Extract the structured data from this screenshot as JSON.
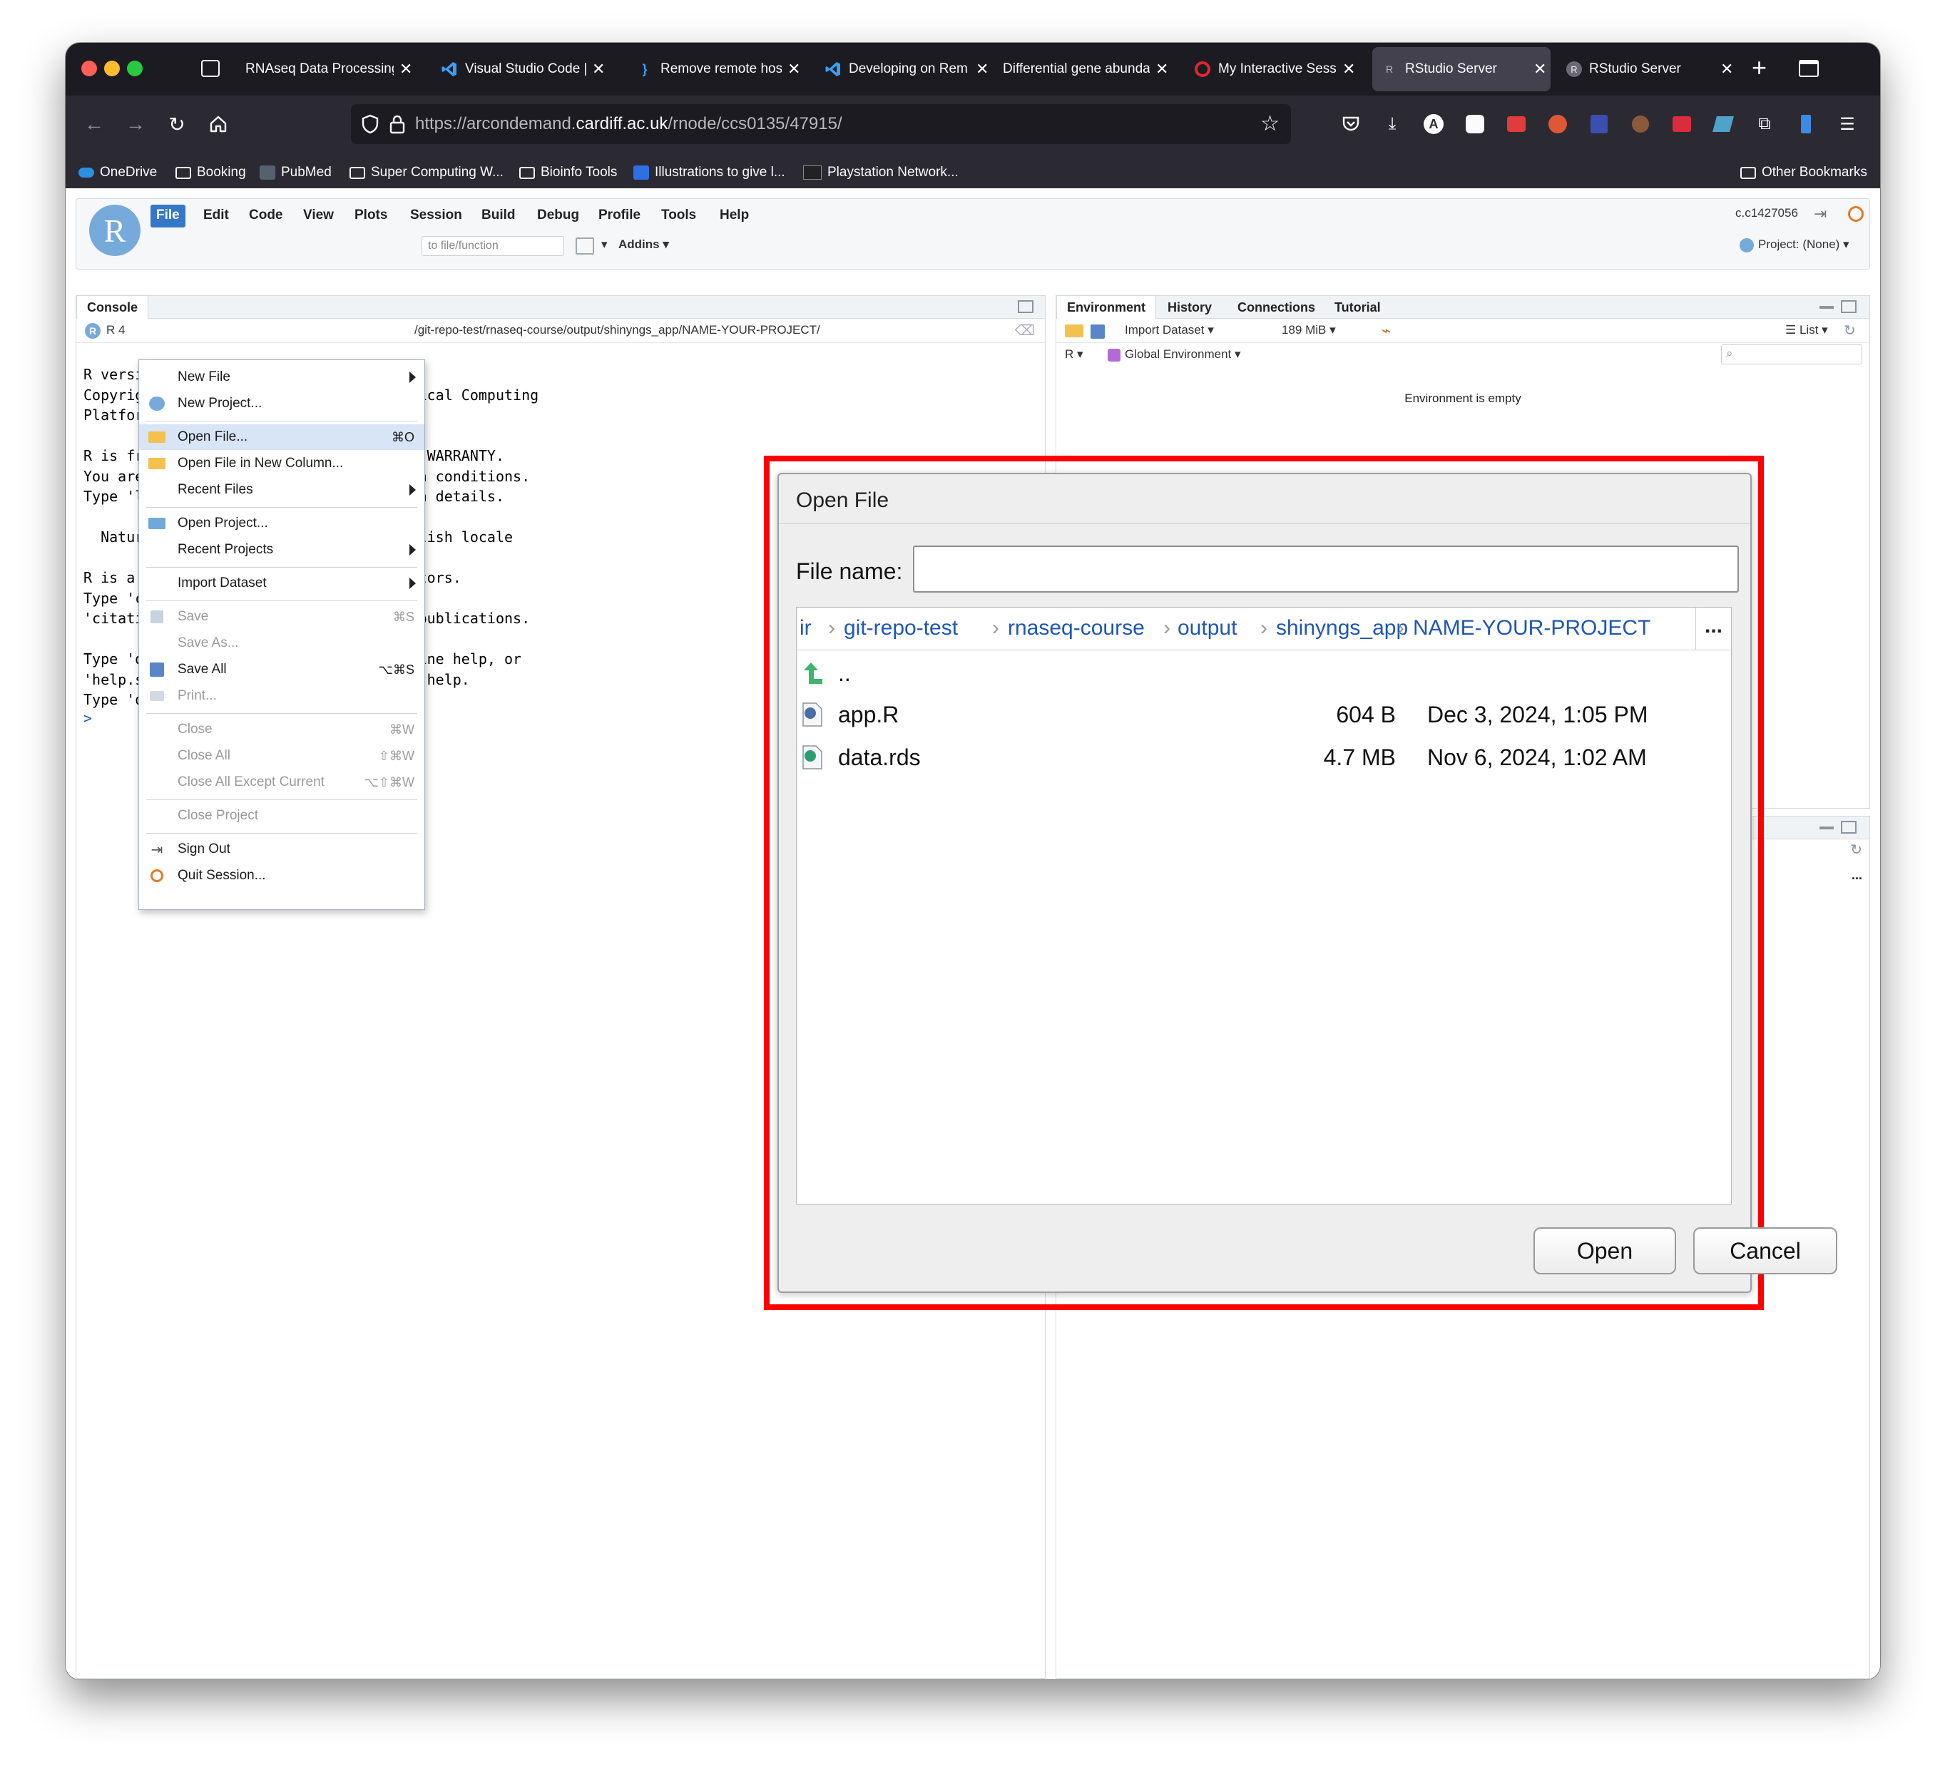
{
  "browser": {
    "tabs": [
      {
        "title": "RNAseq Data Processing",
        "icon": "sidebar-tabs-icon",
        "active": false
      },
      {
        "title": "Visual Studio Code |",
        "icon": "vscode-icon",
        "active": false
      },
      {
        "title": "Remove remote hos",
        "icon": "brackets-icon",
        "active": false
      },
      {
        "title": "Developing on Rem",
        "icon": "vscode-icon",
        "active": false
      },
      {
        "title": "Differential gene abunda",
        "icon": "none",
        "active": false
      },
      {
        "title": "My Interactive Sess",
        "icon": "ood-icon",
        "active": false
      },
      {
        "title": "RStudio Server",
        "icon": "rstudio-icon",
        "active": true
      },
      {
        "title": "RStudio Server",
        "icon": "rstudio-icon",
        "active": false
      }
    ],
    "url_prefix": "https://arcondemand.",
    "url_domain": "cardiff.ac.uk",
    "url_path": "/rnode/ccs0135/47915/",
    "bookmarks": [
      "OneDrive",
      "Booking",
      "PubMed",
      "Super Computing W...",
      "Bioinfo Tools",
      "Illustrations to give l...",
      "Playstation Network..."
    ],
    "other_bookmarks": "Other Bookmarks"
  },
  "rstudio": {
    "menus": [
      "File",
      "Edit",
      "Code",
      "View",
      "Plots",
      "Session",
      "Build",
      "Debug",
      "Profile",
      "Tools",
      "Help"
    ],
    "user": "c.c1427056",
    "goto_placeholder": "to file/function",
    "addins": "Addins",
    "project": "Project: (None)",
    "console_tab": "Console",
    "console_r": "R 4",
    "console_path": "/git-repo-test/rnaseq-course/output/shinyngs_app/NAME-YOUR-PROJECT/",
    "console_lines": [
      "R versi                          p\"",
      "Copyrig                          tatistical Computing",
      "Platfor",
      "",
      "R is fr                          ELY NO WARRANTY.",
      "You are                          certain conditions.",
      "Type 'l                          ibution details.",
      "",
      "  Natur                          an English locale",
      "",
      "R is a                           ntributors.",
      "Type 'c                          n and",
      "'citati                          es in publications.",
      "",
      "Type 'd                          r on-line help, or",
      "'help.s                          ace to help.",
      "Type 'q"
    ],
    "console_prompt": ">",
    "env_tabs": [
      "Environment",
      "History",
      "Connections",
      "Tutorial"
    ],
    "import_dataset": "Import Dataset",
    "memory": "189 MiB",
    "list_label": "List",
    "r_lang": "R",
    "global_env": "Global Environment",
    "env_empty": "Environment is empty"
  },
  "file_menu": {
    "items": [
      {
        "label": "New File",
        "shortcut": "",
        "submenu": true,
        "disabled": false,
        "icon": "none"
      },
      {
        "label": "New Project...",
        "shortcut": "",
        "submenu": false,
        "disabled": false,
        "icon": "new-project-icon"
      },
      {
        "label": "Open File...",
        "shortcut": "⌘O",
        "submenu": false,
        "disabled": false,
        "icon": "open-folder-icon",
        "highlighted": true
      },
      {
        "label": "Open File in New Column...",
        "shortcut": "",
        "submenu": false,
        "disabled": false,
        "icon": "open-folder-icon"
      },
      {
        "label": "Recent Files",
        "shortcut": "",
        "submenu": true,
        "disabled": false,
        "icon": "none"
      },
      {
        "label": "Open Project...",
        "shortcut": "",
        "submenu": false,
        "disabled": false,
        "icon": "open-project-icon"
      },
      {
        "label": "Recent Projects",
        "shortcut": "",
        "submenu": true,
        "disabled": false,
        "icon": "none"
      },
      {
        "label": "Import Dataset",
        "shortcut": "",
        "submenu": true,
        "disabled": false,
        "icon": "none"
      },
      {
        "label": "Save",
        "shortcut": "⌘S",
        "submenu": false,
        "disabled": true,
        "icon": "save-icon"
      },
      {
        "label": "Save As...",
        "shortcut": "",
        "submenu": false,
        "disabled": true,
        "icon": "none"
      },
      {
        "label": "Save All",
        "shortcut": "⌥⌘S",
        "submenu": false,
        "disabled": false,
        "icon": "save-all-icon"
      },
      {
        "label": "Print...",
        "shortcut": "",
        "submenu": false,
        "disabled": true,
        "icon": "print-icon"
      },
      {
        "label": "Close",
        "shortcut": "⌘W",
        "submenu": false,
        "disabled": true,
        "icon": "none"
      },
      {
        "label": "Close All",
        "shortcut": "⇧⌘W",
        "submenu": false,
        "disabled": true,
        "icon": "none"
      },
      {
        "label": "Close All Except Current",
        "shortcut": "⌥⇧⌘W",
        "submenu": false,
        "disabled": true,
        "icon": "none"
      },
      {
        "label": "Close Project",
        "shortcut": "",
        "submenu": false,
        "disabled": true,
        "icon": "none"
      },
      {
        "label": "Sign Out",
        "shortcut": "",
        "submenu": false,
        "disabled": false,
        "icon": "sign-out-icon"
      },
      {
        "label": "Quit Session...",
        "shortcut": "",
        "submenu": false,
        "disabled": false,
        "icon": "power-icon"
      }
    ]
  },
  "dialog": {
    "title": "Open File",
    "file_name_label": "File name:",
    "file_name_value": "",
    "breadcrumbs": [
      "ir",
      "git-repo-test",
      "rnaseq-course",
      "output",
      "shinyngs_app",
      "NAME-YOUR-PROJECT"
    ],
    "more": "...",
    "parent": "..",
    "files": [
      {
        "name": "app.R",
        "size": "604 B",
        "date": "Dec 3, 2024, 1:05 PM",
        "icon": "r-file-icon"
      },
      {
        "name": "data.rds",
        "size": "4.7 MB",
        "date": "Nov 6, 2024, 1:02 AM",
        "icon": "rds-file-icon"
      }
    ],
    "open_label": "Open",
    "cancel_label": "Cancel"
  },
  "colors": {
    "highlight": "#ff0000",
    "menu_active": "#3578c8",
    "link": "#1f57b3",
    "r_logo": "#75aadb"
  }
}
